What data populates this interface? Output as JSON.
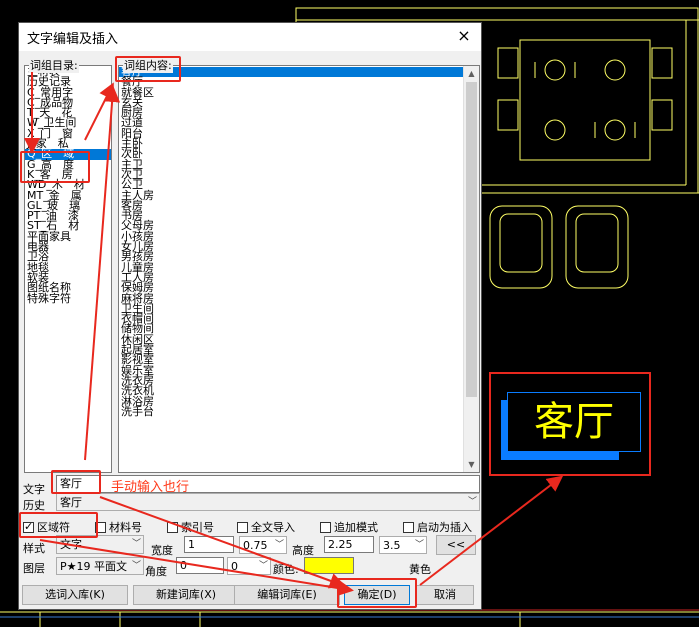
{
  "dialog": {
    "title": "文字编辑及插入",
    "close": "×"
  },
  "catalog": {
    "label": "词组目录:",
    "items": [
      "主材表",
      "历史记录",
      "C_常用字",
      "C_成品物",
      "T_天　花",
      "W_卫生间",
      "X_门　窗",
      "J_家　私",
      "Q_区　域",
      "G_高　度",
      "K_客　房",
      "WD_木　材",
      "MT_金　属",
      "GL_玻　璃",
      "PT_油　漆",
      "ST_石　材",
      "平面家具",
      "电器",
      "卫浴",
      "地毯",
      "软装",
      "图纸名称",
      "特殊字符"
    ],
    "selected_index": 8
  },
  "content": {
    "label": "词组内容:",
    "items": [
      "客厅",
      "餐厅",
      "就餐区",
      "玄关",
      "厨房",
      "过道",
      "阳台",
      "主卧",
      "次卧",
      "主卫",
      "次卫",
      "公卫",
      "主人房",
      "客房",
      "书房",
      "父母房",
      "小孩房",
      "女儿房",
      "男孩房",
      "儿童房",
      "工人房",
      "保姆房",
      "麻将房",
      "卫生间",
      "衣帽间",
      "储物间",
      "休闲区",
      "起居室",
      "影视室",
      "娱乐室",
      "洗衣房",
      "洗衣机",
      "淋浴房",
      "洗手台"
    ],
    "selected_index": 0
  },
  "form": {
    "text_label": "文字",
    "text_value": "客厅",
    "history_label": "历史",
    "history_value": "客厅",
    "checks": [
      {
        "label": "区域符",
        "checked": true
      },
      {
        "label": "材料号",
        "checked": false
      },
      {
        "label": "索引号",
        "checked": false
      },
      {
        "label": "全文导入",
        "checked": false
      },
      {
        "label": "追加模式",
        "checked": false
      },
      {
        "label": "启动为插入",
        "checked": false
      }
    ],
    "style_label": "样式",
    "style_value": "文字",
    "width_label": "宽度",
    "width_value": "1",
    "width_factor": "0.75",
    "height_label": "高度",
    "height_value": "2.25",
    "height_factor": "3.5",
    "collapse_button": "<<",
    "layer_label": "图层",
    "layer_value": "P★19 平面文",
    "angle_label": "角度",
    "angle_value": "0",
    "angle_extra": "0",
    "color_label": "颜色:",
    "color_name": "黄色",
    "color_hex": "#ffff00"
  },
  "buttons": {
    "import": "选词入库(K)",
    "new_lib": "新建词库(X)",
    "edit_lib": "编辑词库(E)",
    "ok": "确定(D)",
    "cancel": "取消"
  },
  "annotation": "手动输入也行",
  "preview_text": "客厅",
  "colors": {
    "accent": "#0078d7",
    "annotation_red": "#e8281e",
    "cad_yellow": "#ffff00",
    "cad_blue": "#0a7cff"
  }
}
